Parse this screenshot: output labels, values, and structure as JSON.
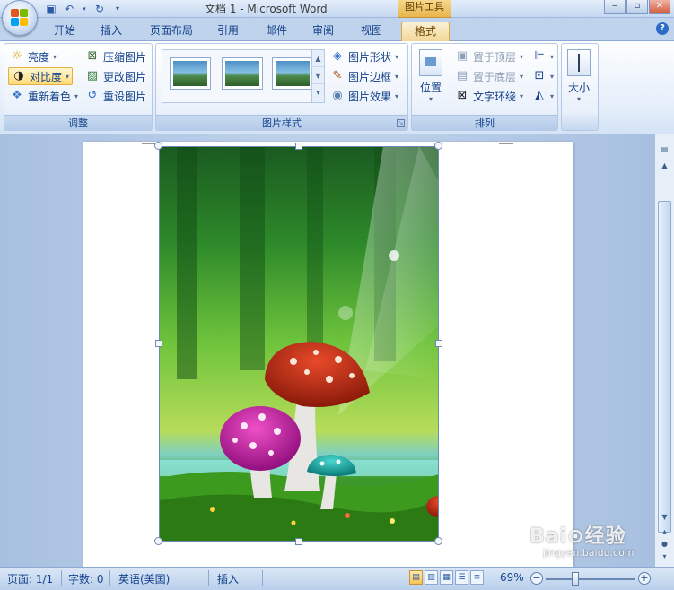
{
  "window": {
    "title": "文档 1 - Microsoft Word",
    "context_tab": "图片工具",
    "help_glyph": "?"
  },
  "tabs": [
    {
      "label": "开始",
      "active": false
    },
    {
      "label": "插入",
      "active": false
    },
    {
      "label": "页面布局",
      "active": false
    },
    {
      "label": "引用",
      "active": false
    },
    {
      "label": "邮件",
      "active": false
    },
    {
      "label": "审阅",
      "active": false
    },
    {
      "label": "视图",
      "active": false
    },
    {
      "label": "格式",
      "active": true
    }
  ],
  "ribbon": {
    "adjust": {
      "label": "调整",
      "brightness": "亮度",
      "contrast": "对比度",
      "recolor": "重新着色",
      "compress": "压缩图片",
      "change_picture": "更改图片",
      "reset_picture": "重设图片"
    },
    "picture_styles": {
      "label": "图片样式",
      "shape": "图片形状",
      "border": "图片边框",
      "effects": "图片效果"
    },
    "arrange": {
      "label": "排列",
      "position": "位置",
      "bring_front": "置于顶层",
      "send_back": "置于底层",
      "text_wrap": "文字环绕"
    },
    "size": {
      "label": "大小"
    }
  },
  "statusbar": {
    "page": "页面: 1/1",
    "words": "字数: 0",
    "language": "英语(美国)",
    "mode": "插入",
    "zoom": "69%"
  },
  "watermark": {
    "brand": "Bai⊙经验",
    "url": "jingyan.baidu.com"
  },
  "colors": {
    "ribbon_blue": "#15428b",
    "active_tab": "#f2d798",
    "context_tab": "#e8b54d"
  }
}
